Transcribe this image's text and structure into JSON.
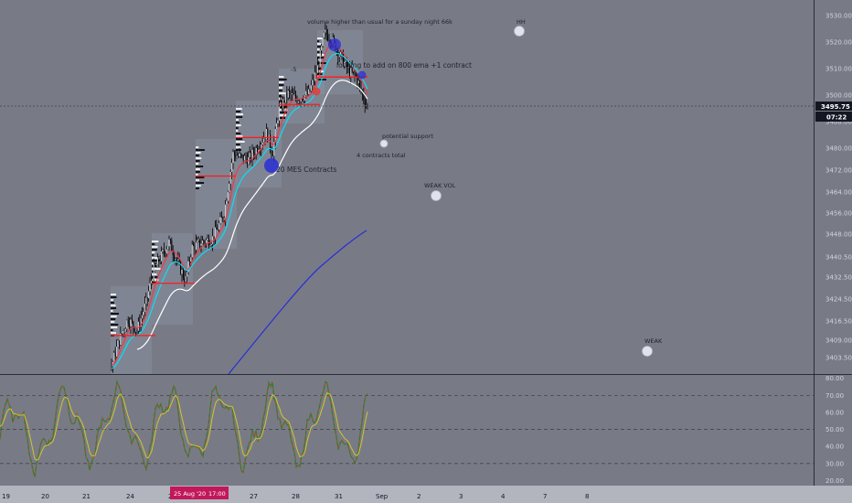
{
  "colors": {
    "background": "#787b86",
    "candle": "#000000",
    "ema_fast": "#f23645",
    "ema_mid": "#26a69a",
    "ema_slow": "#00e5ff",
    "ema_white": "#ffffff",
    "ema_blue": "#2a2ed6",
    "level_line": "#ff1a1a",
    "rsi_line": "#2e7d32",
    "rsi_signal": "#d4c42c",
    "rsi_red": "#e53935",
    "price_tag_bg": "#131722",
    "date_tag_bg": "#c2185b"
  },
  "price_axis": {
    "ticks": [
      "3530.00",
      "3520.00",
      "3510.00",
      "3500.00",
      "3488.00",
      "3480.00",
      "3472.00",
      "3464.00",
      "3456.00",
      "3448.00",
      "3440.50",
      "3432.50",
      "3424.50",
      "3416.50",
      "3409.00",
      "3403.50"
    ],
    "current_price": "3495.75",
    "countdown": "07:22"
  },
  "rsi_axis": {
    "ticks": [
      "80.00",
      "70.00",
      "60.00",
      "50.00",
      "40.00",
      "30.00",
      "20.00"
    ],
    "levels": [
      70,
      50,
      30
    ]
  },
  "time_axis": {
    "ticks": [
      "19",
      "20",
      "21",
      "24",
      "25",
      "26",
      "27",
      "28",
      "31",
      "Sep",
      "2",
      "3",
      "4",
      "7",
      "8"
    ],
    "date_tag": "25 Aug '20",
    "time_tag": "17:00"
  },
  "annotations": {
    "volume_note": "volume higher than usual for a sunday night 66k",
    "add_note": "looking to add on 800 ema +1 contract",
    "mes_contracts": "20 MES Contracts",
    "potential_support": "potential support",
    "contracts_total": "4 contracts total",
    "minus_five": "-5",
    "hh": "HH",
    "weak_vol": "WEAK VOL",
    "weak": "WEAK"
  },
  "chart_data": {
    "type": "line",
    "panes": [
      {
        "name": "price",
        "series_type": "candlestick",
        "ylim": [
          3398,
          3534
        ],
        "x_categories": [
          "19",
          "20",
          "21",
          "24",
          "25",
          "26",
          "27",
          "28",
          "31",
          "Sep"
        ],
        "approx_close_path": [
          3402,
          3412,
          3418,
          3430,
          3440,
          3447,
          3456,
          3478,
          3490,
          3500,
          3508,
          3518,
          3524,
          3512,
          3505,
          3496
        ],
        "horizontal_levels": [
          3476.5,
          3485.5,
          3498.5,
          3497.5,
          3506.0,
          3470.5
        ]
      },
      {
        "name": "rsi",
        "series_type": "line",
        "ylim": [
          17,
          82
        ],
        "guide_levels": [
          70,
          50,
          30
        ]
      }
    ]
  }
}
